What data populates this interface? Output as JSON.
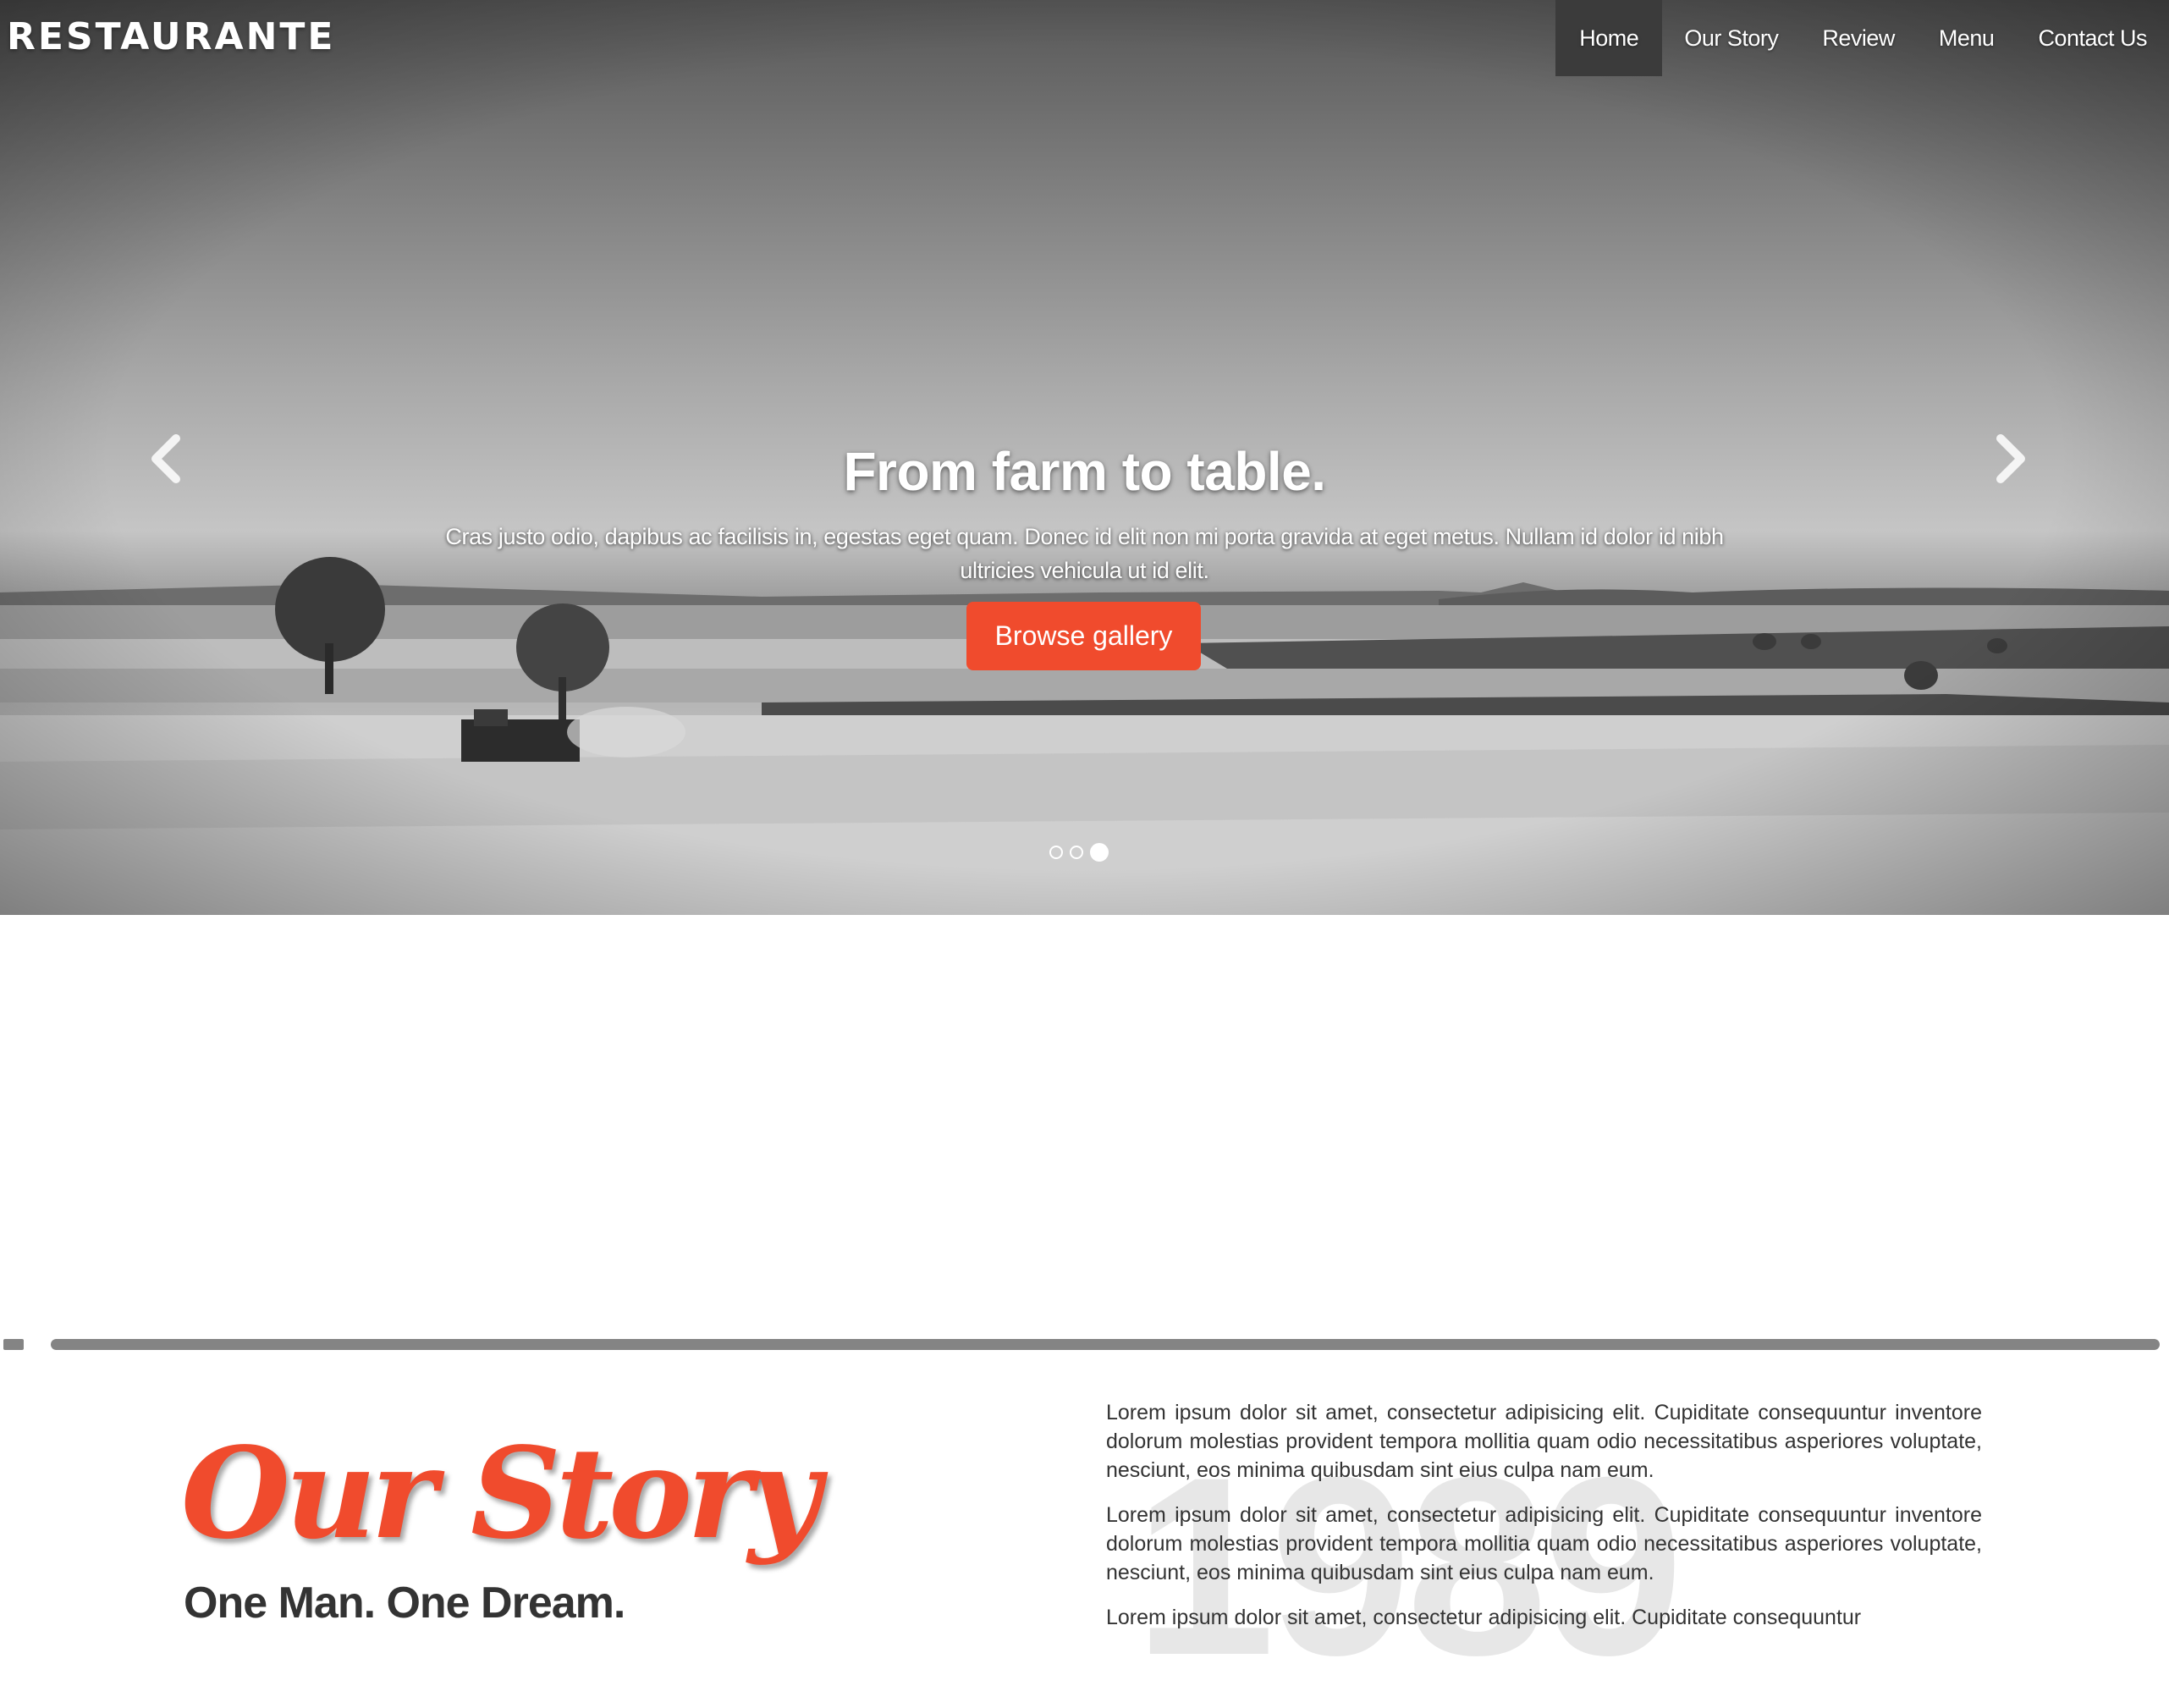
{
  "header": {
    "logo": "RESTAURANTE",
    "nav": [
      "Home",
      "Our Story",
      "Review",
      "Menu",
      "Contact Us"
    ],
    "active_nav": "Home"
  },
  "hero": {
    "title": "From farm to table.",
    "text": "Cras justo odio, dapibus ac facilisis in, egestas eget quam. Donec id elit non mi porta gravida at eget metus. Nullam id dolor id nibh ultricies vehicula ut id elit.",
    "button": "Browse gallery",
    "slide_count": 3,
    "active_slide": 3
  },
  "story": {
    "title": "Our Story",
    "subtitle": "One Man. One Dream.",
    "year": "1989",
    "paragraphs": [
      "Lorem ipsum dolor sit amet, consectetur adipisicing elit. Cupiditate consequuntur inventore dolorum molestias provident tempora mollitia quam odio necessitatibus asperiores voluptate, nesciunt, eos minima quibusdam sint eius culpa nam eum.",
      "Lorem ipsum dolor sit amet, consectetur adipisicing elit. Cupiditate consequuntur inventore dolorum molestias provident tempora mollitia quam odio necessitatibus asperiores voluptate, nesciunt, eos minima quibusdam sint eius culpa nam eum.",
      "Lorem ipsum dolor sit amet, consectetur adipisicing elit. Cupiditate consequuntur"
    ]
  },
  "colors": {
    "accent": "#f04b2d",
    "nav_active_bg": "#3b3b3b",
    "divider": "#848484"
  },
  "icons": {
    "prev": "chevron-left-icon",
    "next": "chevron-right-icon"
  }
}
